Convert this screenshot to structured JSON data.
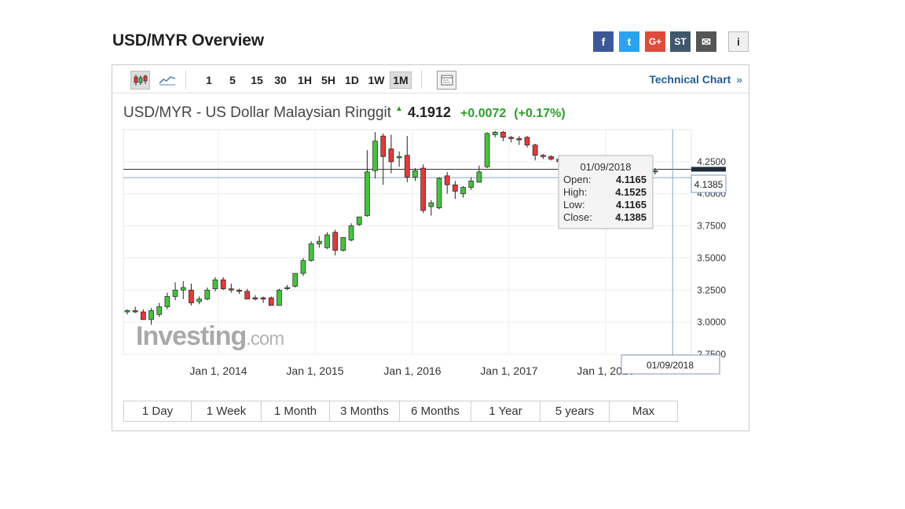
{
  "page": {
    "title": "USD/MYR Overview"
  },
  "share": [
    {
      "icon": "facebook-icon",
      "glyph": "f",
      "color": "#3b5998"
    },
    {
      "icon": "twitter-icon",
      "glyph": "t",
      "color": "#2aa3ef"
    },
    {
      "icon": "google-plus-icon",
      "glyph": "G+",
      "color": "#dd4b39"
    },
    {
      "icon": "stocktwits-icon",
      "glyph": "ST",
      "color": "#40576d"
    },
    {
      "icon": "email-icon",
      "glyph": "✉",
      "color": "#555555"
    },
    {
      "icon": "info-icon",
      "glyph": "i",
      "color": "#f0f0f0"
    }
  ],
  "toolbar": {
    "intervals": [
      "1",
      "5",
      "15",
      "30",
      "1H",
      "5H",
      "1D",
      "1W",
      "1M"
    ],
    "active_interval": "1M",
    "technical_chart_label": "Technical Chart",
    "technical_chart_chevron": "»"
  },
  "quote": {
    "name": "USD/MYR - US Dollar Malaysian Ringgit",
    "last": "4.1912",
    "change": "+0.0072",
    "change_pct": "(+0.17%)",
    "direction": "up"
  },
  "tooltip": {
    "date": "01/09/2018",
    "open_label": "Open:",
    "open": "4.1165",
    "high_label": "High:",
    "high": "4.1525",
    "low_label": "Low:",
    "low": "4.1165",
    "close_label": "Close:",
    "close": "4.1385"
  },
  "crosshair": {
    "date_label": "01/09/2018",
    "price_label": "4.1385"
  },
  "watermark": {
    "brand": "Investing",
    "suffix": ".com"
  },
  "chart_data": {
    "type": "candlestick",
    "ylim": [
      2.75,
      4.5
    ],
    "y_ticks": [
      "2.7500",
      "3.0000",
      "3.2500",
      "3.5000",
      "3.7500",
      "4.0000",
      "4.2500"
    ],
    "x_ticks": [
      "Jan 1, 2014",
      "Jan 1, 2015",
      "Jan 1, 2016",
      "Jan 1, 2017",
      "Jan 1, 2018"
    ],
    "grid": true,
    "up_color": "#44c33d",
    "down_color": "#e23a3a",
    "horizontal_lines": [
      4.1912,
      4.1385
    ],
    "candles": [
      [
        3.08,
        3.1,
        3.06,
        3.09
      ],
      [
        3.09,
        3.12,
        3.07,
        3.08
      ],
      [
        3.08,
        3.1,
        3.04,
        3.02
      ],
      [
        3.02,
        3.11,
        2.98,
        3.09
      ],
      [
        3.06,
        3.15,
        3.04,
        3.12
      ],
      [
        3.12,
        3.23,
        3.1,
        3.2
      ],
      [
        3.2,
        3.31,
        3.17,
        3.25
      ],
      [
        3.25,
        3.32,
        3.18,
        3.27
      ],
      [
        3.25,
        3.3,
        3.13,
        3.15
      ],
      [
        3.16,
        3.2,
        3.14,
        3.18
      ],
      [
        3.18,
        3.27,
        3.17,
        3.25
      ],
      [
        3.26,
        3.35,
        3.24,
        3.33
      ],
      [
        3.33,
        3.35,
        3.25,
        3.26
      ],
      [
        3.26,
        3.3,
        3.23,
        3.25
      ],
      [
        3.25,
        3.26,
        3.22,
        3.24
      ],
      [
        3.24,
        3.26,
        3.19,
        3.18
      ],
      [
        3.19,
        3.21,
        3.17,
        3.18
      ],
      [
        3.19,
        3.2,
        3.15,
        3.18
      ],
      [
        3.19,
        3.2,
        3.14,
        3.13
      ],
      [
        3.13,
        3.26,
        3.13,
        3.25
      ],
      [
        3.26,
        3.29,
        3.25,
        3.27
      ],
      [
        3.28,
        3.36,
        3.27,
        3.38
      ],
      [
        3.38,
        3.5,
        3.36,
        3.48
      ],
      [
        3.48,
        3.63,
        3.47,
        3.61
      ],
      [
        3.61,
        3.67,
        3.58,
        3.63
      ],
      [
        3.58,
        3.7,
        3.57,
        3.68
      ],
      [
        3.7,
        3.72,
        3.52,
        3.56
      ],
      [
        3.56,
        3.66,
        3.55,
        3.66
      ],
      [
        3.64,
        3.77,
        3.63,
        3.75
      ],
      [
        3.76,
        3.82,
        3.75,
        3.82
      ],
      [
        3.83,
        4.34,
        3.82,
        4.17
      ],
      [
        4.18,
        4.48,
        4.12,
        4.41
      ],
      [
        4.45,
        4.47,
        4.07,
        4.29
      ],
      [
        4.35,
        4.46,
        4.16,
        4.25
      ],
      [
        4.28,
        4.33,
        4.21,
        4.29
      ],
      [
        4.3,
        4.45,
        4.09,
        4.13
      ],
      [
        4.13,
        4.2,
        4.1,
        4.18
      ],
      [
        4.2,
        4.23,
        3.85,
        3.87
      ],
      [
        3.9,
        3.95,
        3.83,
        3.93
      ],
      [
        3.89,
        4.13,
        3.88,
        4.12
      ],
      [
        4.14,
        4.17,
        4.0,
        4.07
      ],
      [
        4.07,
        4.1,
        3.96,
        4.02
      ],
      [
        4.0,
        4.06,
        3.97,
        4.05
      ],
      [
        4.05,
        4.13,
        4.03,
        4.1
      ],
      [
        4.09,
        4.22,
        4.09,
        4.17
      ],
      [
        4.21,
        4.48,
        4.2,
        4.47
      ],
      [
        4.46,
        4.49,
        4.44,
        4.48
      ],
      [
        4.48,
        4.49,
        4.41,
        4.44
      ],
      [
        4.44,
        4.45,
        4.4,
        4.43
      ],
      [
        4.43,
        4.45,
        4.38,
        4.42
      ],
      [
        4.44,
        4.45,
        4.36,
        4.38
      ],
      [
        4.38,
        4.39,
        4.26,
        4.3
      ],
      [
        4.3,
        4.31,
        4.27,
        4.29
      ],
      [
        4.29,
        4.3,
        4.26,
        4.27
      ],
      [
        4.27,
        4.3,
        4.24,
        4.25
      ],
      [
        4.25,
        4.28,
        4.2,
        4.22
      ],
      [
        4.21,
        4.24,
        4.18,
        4.2
      ],
      [
        4.2,
        4.22,
        4.17,
        4.19
      ],
      [
        4.19,
        4.21,
        4.15,
        4.17
      ],
      [
        4.17,
        4.19,
        4.13,
        4.15
      ],
      [
        4.15,
        4.17,
        4.09,
        4.11
      ],
      [
        4.11,
        4.13,
        4.06,
        4.08
      ],
      [
        4.04,
        4.1,
        4.01,
        4.09
      ],
      [
        4.09,
        4.13,
        4.07,
        4.12
      ],
      [
        4.1165,
        4.1525,
        4.1165,
        4.1385
      ],
      [
        4.14,
        4.19,
        4.13,
        4.19
      ],
      [
        4.17,
        4.2,
        4.15,
        4.18
      ]
    ]
  },
  "range_buttons": [
    "1 Day",
    "1 Week",
    "1 Month",
    "3 Months",
    "6 Months",
    "1 Year",
    "5 years",
    "Max"
  ]
}
